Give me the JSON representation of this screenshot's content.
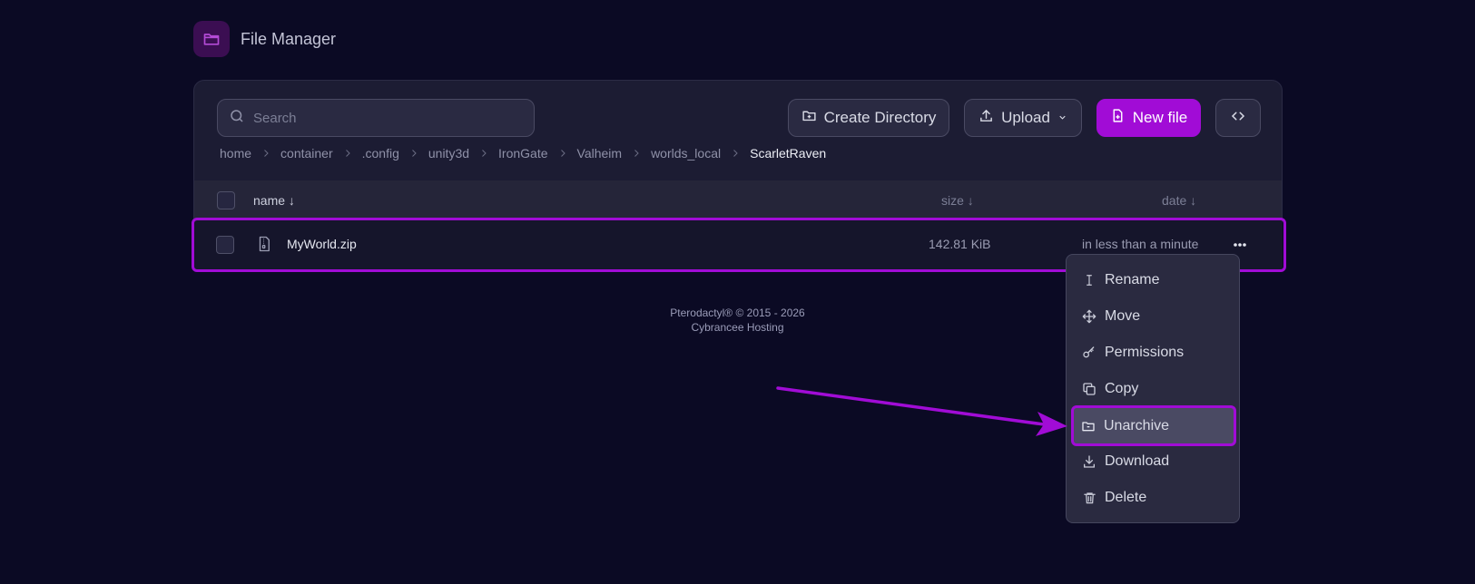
{
  "app": {
    "title": "File Manager"
  },
  "toolbar": {
    "search_placeholder": "Search",
    "create_directory": "Create Directory",
    "upload": "Upload",
    "new_file": "New file"
  },
  "breadcrumb": [
    "home",
    "container",
    ".config",
    "unity3d",
    "IronGate",
    "Valheim",
    "worlds_local",
    "ScarletRaven"
  ],
  "table": {
    "columns": {
      "name": "name ↓",
      "size": "size ↓",
      "date": "date ↓"
    },
    "rows": [
      {
        "name": "MyWorld.zip",
        "size": "142.81 KiB",
        "date": "in less than a minute"
      }
    ]
  },
  "context_menu": {
    "items": [
      {
        "label": "Rename",
        "icon": "text-cursor-icon"
      },
      {
        "label": "Move",
        "icon": "move-icon"
      },
      {
        "label": "Permissions",
        "icon": "key-icon"
      },
      {
        "label": "Copy",
        "icon": "copy-icon"
      },
      {
        "label": "Unarchive",
        "icon": "folder-open-icon",
        "highlighted": true
      },
      {
        "label": "Download",
        "icon": "download-icon"
      },
      {
        "label": "Delete",
        "icon": "trash-icon"
      }
    ]
  },
  "footer": {
    "line1": "Pterodactyl® © 2015 - 2026",
    "line2": "Cybrancee Hosting"
  },
  "colors": {
    "background": "#0b0a24",
    "panel": "#1c1c33",
    "accent": "#a10cd6"
  }
}
